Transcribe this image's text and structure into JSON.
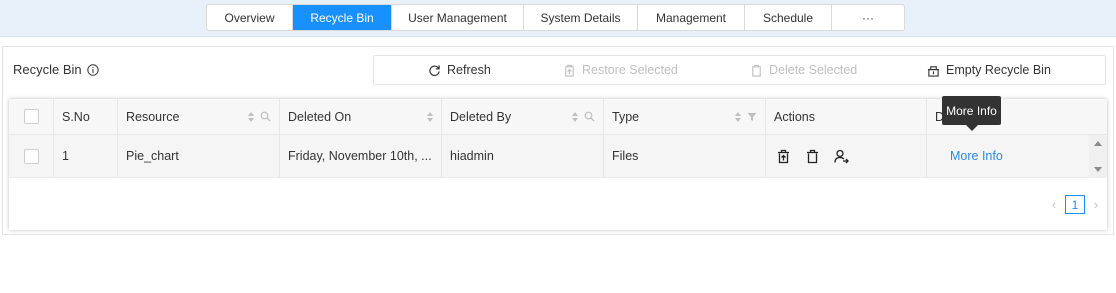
{
  "tabs": [
    {
      "label": "Overview",
      "active": false
    },
    {
      "label": "Recycle Bin",
      "active": true
    },
    {
      "label": "User Management",
      "active": false
    },
    {
      "label": "System Details",
      "active": false
    },
    {
      "label": "Management",
      "active": false
    },
    {
      "label": "Schedule",
      "active": false
    },
    {
      "label": "···",
      "active": false
    }
  ],
  "panel": {
    "title": "Recycle Bin"
  },
  "toolbar": {
    "refresh": "Refresh",
    "restore": "Restore Selected",
    "delete": "Delete Selected",
    "empty": "Empty Recycle Bin"
  },
  "table": {
    "headers": {
      "sno": "S.No",
      "resource": "Resource",
      "deleted_on": "Deleted On",
      "deleted_by": "Deleted By",
      "type": "Type",
      "actions": "Actions",
      "details": "Details"
    },
    "rows": [
      {
        "sno": "1",
        "resource": "Pie_chart",
        "deleted_on": "Friday, November 10th, ...",
        "deleted_by": "hiadmin",
        "type": "Files",
        "details_link": "More Info"
      }
    ]
  },
  "pagination": {
    "current_page": "1",
    "prev": "‹",
    "next": "›"
  },
  "tooltip": {
    "text": "More Info"
  },
  "colors": {
    "accent": "#1890ff",
    "link": "#2d8bdf"
  }
}
